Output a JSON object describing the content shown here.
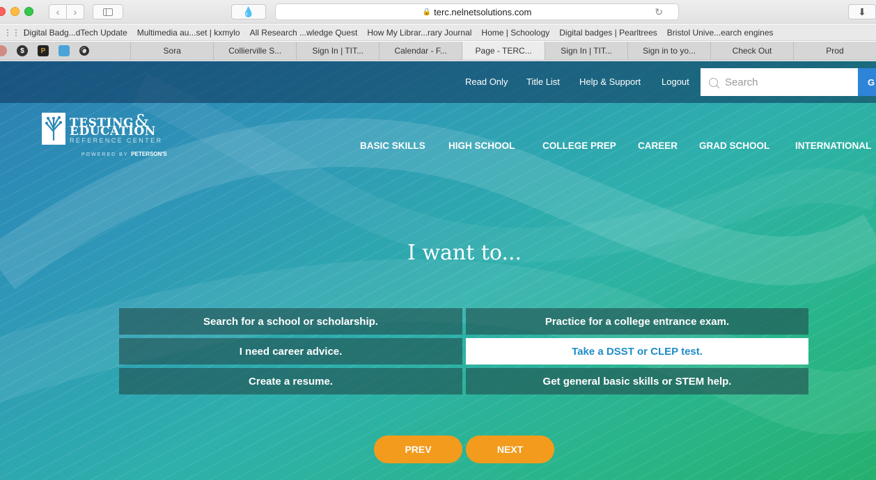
{
  "browser": {
    "url": "terc.nelnetsolutions.com",
    "icons": {
      "back": "chevron-left-icon",
      "forward": "chevron-right-icon",
      "sidebar": "sidebar-icon",
      "extension": "drop-icon",
      "lock": "lock-icon",
      "reload": "reload-icon",
      "downloads": "download-icon",
      "favorites": "grid-icon"
    },
    "glyphs": {
      "back": "‹",
      "forward": "›",
      "extension": "💧",
      "lock": "🔒",
      "reload": "↻",
      "downloads": "⬇",
      "grid": "⋮⋮⋮"
    },
    "bookmarks": [
      "Digital Badg...dTech Update",
      "Multimedia au...set | kxmylo",
      "All Research ...wledge Quest",
      "How My Librar...rary Journal",
      "Home | Schoology",
      "Digital badges | Pearltrees",
      "Bristol Unive...earch engines"
    ],
    "pinned_tabs": {
      "b": "$",
      "c": "P",
      "e": "O"
    },
    "tabs": [
      {
        "label": "Sora"
      },
      {
        "label": "Collierville S..."
      },
      {
        "label": "Sign In | TIT..."
      },
      {
        "label": "Calendar - F..."
      },
      {
        "label": "Page - TERC..."
      },
      {
        "label": "Sign In | TIT..."
      },
      {
        "label": "Sign in to yo..."
      },
      {
        "label": "Check Out"
      },
      {
        "label": "Prod"
      }
    ]
  },
  "site": {
    "top_links": {
      "read_only": "Read Only",
      "title_list": "Title List",
      "help": "Help & Support",
      "logout": "Logout"
    },
    "search": {
      "placeholder": "Search",
      "button": "G"
    },
    "logo": {
      "line1": "TESTING",
      "amp": "&",
      "line2": "EDUCATION",
      "line3": "REFERENCE CENTER",
      "powered_by": "POWERED BY",
      "partner": "PETERSON'S"
    },
    "nav": {
      "basic_skills": "BASIC SKILLS",
      "high_school": "HIGH SCHOOL",
      "college_prep": "COLLEGE PREP",
      "career": "CAREER",
      "grad_school": "GRAD SCHOOL",
      "international": "INTERNATIONAL"
    },
    "headline": "I want to...",
    "choices": {
      "search_school": "Search for a school or scholarship.",
      "practice_exam": "Practice for a college entrance exam.",
      "career_advice": "I need career advice.",
      "dsst_clep": "Take a DSST or CLEP test.",
      "resume": "Create a resume.",
      "basic_skills": "Get general basic skills or STEM help."
    },
    "pager": {
      "prev": "PREV",
      "next": "NEXT"
    },
    "colors": {
      "accent_orange": "#f29b1d",
      "selected_text": "#1f8cc6",
      "go_button": "#2d84d8"
    }
  }
}
